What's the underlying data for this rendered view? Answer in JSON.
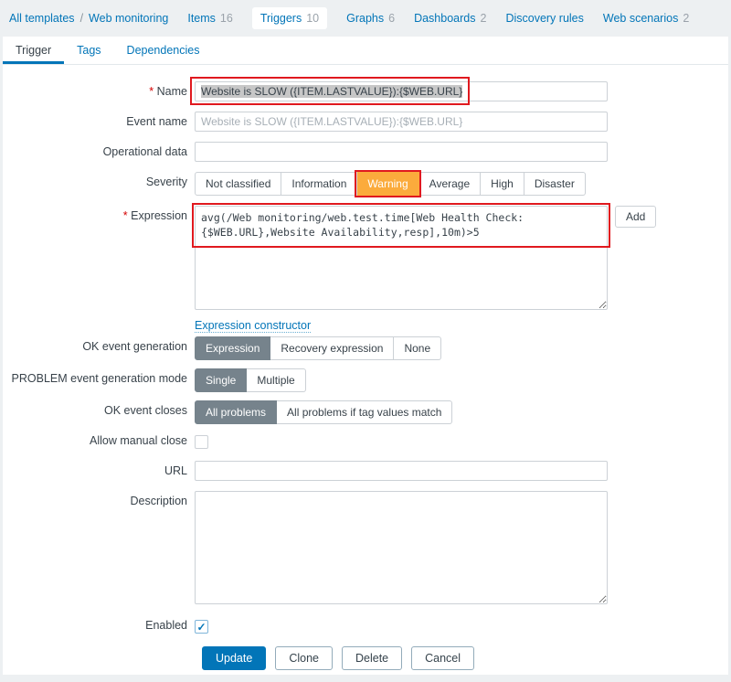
{
  "topnav": {
    "breadcrumb": {
      "items": [
        "All templates",
        "Web monitoring"
      ],
      "separator": "/"
    },
    "nav": [
      {
        "label": "Items",
        "count": "16"
      },
      {
        "label": "Triggers",
        "count": "10"
      },
      {
        "label": "Graphs",
        "count": "6"
      },
      {
        "label": "Dashboards",
        "count": "2"
      },
      {
        "label": "Discovery rules",
        "count": ""
      },
      {
        "label": "Web scenarios",
        "count": "2"
      }
    ]
  },
  "tabs": [
    {
      "label": "Trigger"
    },
    {
      "label": "Tags"
    },
    {
      "label": "Dependencies"
    }
  ],
  "form": {
    "required_marker": "*",
    "name": {
      "label": "Name",
      "value": "Website is SLOW ({ITEM.LASTVALUE}):{$WEB.URL}"
    },
    "event_name": {
      "label": "Event name",
      "placeholder": "Website is SLOW ({ITEM.LASTVALUE}):{$WEB.URL}"
    },
    "operational_data": {
      "label": "Operational data",
      "value": ""
    },
    "severity": {
      "label": "Severity",
      "options": [
        "Not classified",
        "Information",
        "Warning",
        "Average",
        "High",
        "Disaster"
      ],
      "selected": "Warning"
    },
    "expression": {
      "label": "Expression",
      "value": "avg(/Web monitoring/web.test.time[Web Health Check:\n{$WEB.URL},Website Availability,resp],10m)>5",
      "add_button": "Add",
      "constructor_link": "Expression constructor"
    },
    "ok_event_generation": {
      "label": "OK event generation",
      "options": [
        "Expression",
        "Recovery expression",
        "None"
      ],
      "selected": "Expression"
    },
    "problem_event_mode": {
      "label": "PROBLEM event generation mode",
      "options": [
        "Single",
        "Multiple"
      ],
      "selected": "Single"
    },
    "ok_event_closes": {
      "label": "OK event closes",
      "options": [
        "All problems",
        "All problems if tag values match"
      ],
      "selected": "All problems"
    },
    "allow_manual_close": {
      "label": "Allow manual close",
      "checked": false
    },
    "url": {
      "label": "URL",
      "value": ""
    },
    "description": {
      "label": "Description",
      "value": ""
    },
    "enabled": {
      "label": "Enabled",
      "checked": true,
      "checkmark": "✓"
    },
    "footer": {
      "update": "Update",
      "clone": "Clone",
      "delete": "Delete",
      "cancel": "Cancel"
    }
  },
  "colors": {
    "accent_blue": "#0275b8",
    "selected_gray": "#76838c",
    "warning_orange": "#fbab3c",
    "annotation_red": "#e0191f"
  }
}
